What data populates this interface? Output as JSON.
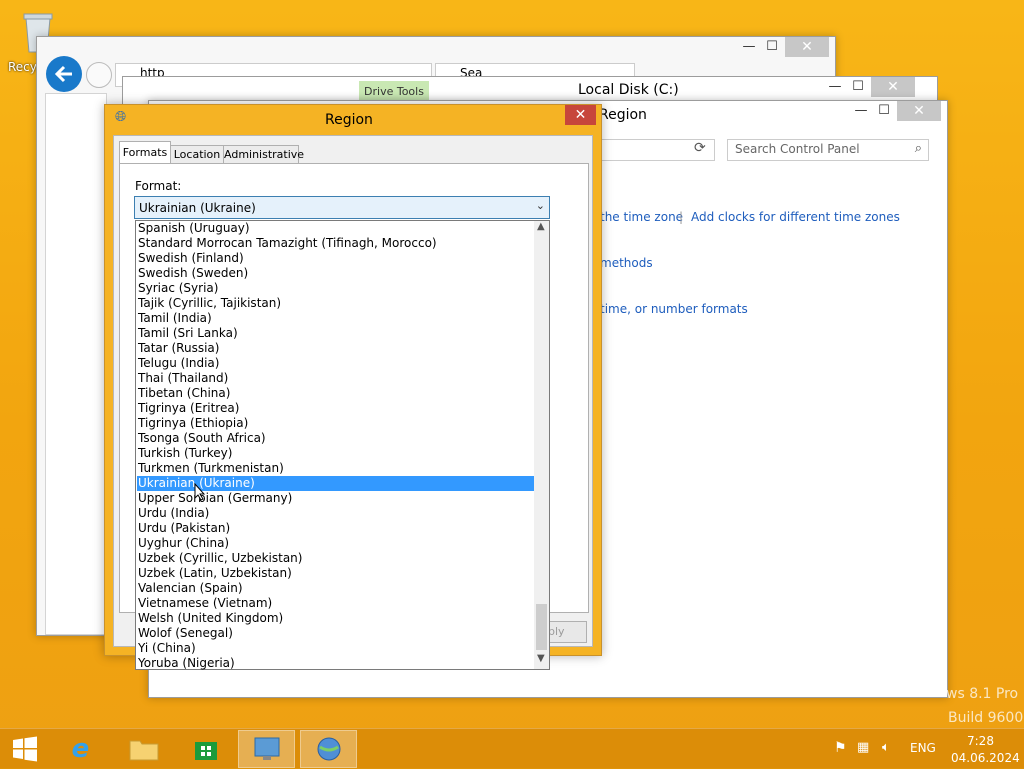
{
  "desktop": {
    "recycle_bin_label": "Recyc"
  },
  "ie_window": {
    "address_text": "http",
    "search_text": "Sea"
  },
  "explorer": {
    "ribbon_tab": "Drive Tools",
    "title": "Local Disk (C:)"
  },
  "control_panel": {
    "title": "Region",
    "search_placeholder": "Search Control Panel",
    "links": {
      "time_zone": "the time zone",
      "add_clocks": "Add clocks for different time zones",
      "methods": "methods",
      "formats": "time, or number formats"
    }
  },
  "watermark": {
    "line1": "ws 8.1 Pro",
    "line2": "Build 9600"
  },
  "dialog": {
    "title": "Region",
    "close_glyph": "✕",
    "tabs": [
      {
        "label": "Formats"
      },
      {
        "label": "Location"
      },
      {
        "label": "Administrative"
      }
    ],
    "format_label": "Format:",
    "selected_format": "Ukrainian (Ukraine)",
    "apply_label": "ply",
    "options": [
      "Spanish (Uruguay)",
      "Standard Morrocan Tamazight (Tifinagh, Morocco)",
      "Swedish (Finland)",
      "Swedish (Sweden)",
      "Syriac (Syria)",
      "Tajik (Cyrillic, Tajikistan)",
      "Tamil (India)",
      "Tamil (Sri Lanka)",
      "Tatar (Russia)",
      "Telugu (India)",
      "Thai (Thailand)",
      "Tibetan (China)",
      "Tigrinya (Eritrea)",
      "Tigrinya (Ethiopia)",
      "Tsonga (South Africa)",
      "Turkish (Turkey)",
      "Turkmen (Turkmenistan)",
      "Ukrainian (Ukraine)",
      "Upper Sorbian (Germany)",
      "Urdu (India)",
      "Urdu (Pakistan)",
      "Uyghur (China)",
      "Uzbek (Cyrillic, Uzbekistan)",
      "Uzbek (Latin, Uzbekistan)",
      "Valencian (Spain)",
      "Vietnamese (Vietnam)",
      "Welsh (United Kingdom)",
      "Wolof (Senegal)",
      "Yi (China)",
      "Yoruba (Nigeria)"
    ],
    "selected_index": 17
  },
  "taskbar": {
    "language": "ENG",
    "time": "7:28",
    "date": "04.06.2024"
  },
  "colors": {
    "accent": "#f5b324",
    "selection": "#3399ff",
    "close": "#c7463b",
    "desktop": "#f5ab14"
  }
}
